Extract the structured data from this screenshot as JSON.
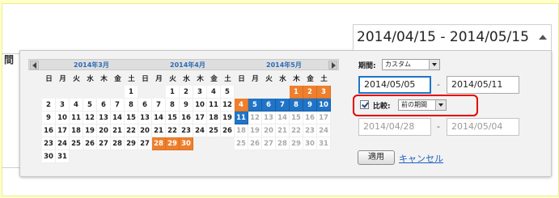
{
  "side_label": "間",
  "date_range_text": "2014/04/15 - 2014/05/15",
  "calendar": {
    "months": [
      {
        "label": "2014年3月",
        "weekdays": [
          "日",
          "月",
          "火",
          "水",
          "木",
          "金",
          "土"
        ],
        "weeks": [
          [
            "",
            "",
            "",
            "",
            "",
            "",
            "1"
          ],
          [
            "2",
            "3",
            "4",
            "5",
            "6",
            "7",
            "8"
          ],
          [
            "9",
            "10",
            "11",
            "12",
            "13",
            "14",
            "15"
          ],
          [
            "16",
            "17",
            "18",
            "19",
            "20",
            "21",
            "22"
          ],
          [
            "23",
            "24",
            "25",
            "26",
            "27",
            "28",
            "29"
          ],
          [
            "30",
            "31",
            "",
            "",
            "",
            "",
            ""
          ]
        ]
      },
      {
        "label": "2014年4月",
        "weekdays": [
          "日",
          "月",
          "火",
          "水",
          "木",
          "金",
          "土"
        ],
        "weeks": [
          [
            "",
            "",
            "1",
            "2",
            "3",
            "4",
            "5"
          ],
          [
            "6",
            "7",
            "8",
            "9",
            "10",
            "11",
            "12"
          ],
          [
            "13",
            "14",
            "15",
            "16",
            "17",
            "18",
            "19"
          ],
          [
            "20",
            "21",
            "22",
            "23",
            "24",
            "25",
            "26"
          ],
          [
            "27",
            "28",
            "29",
            "30",
            "",
            "",
            ""
          ]
        ]
      },
      {
        "label": "2014年5月",
        "weekdays": [
          "日",
          "月",
          "火",
          "水",
          "木",
          "金",
          "土"
        ],
        "weeks": [
          [
            "",
            "",
            "",
            "",
            "1",
            "2",
            "3"
          ],
          [
            "4",
            "5",
            "6",
            "7",
            "8",
            "9",
            "10"
          ],
          [
            "11",
            "12",
            "13",
            "14",
            "15",
            "16",
            "17"
          ],
          [
            "18",
            "19",
            "20",
            "21",
            "22",
            "23",
            "24"
          ],
          [
            "25",
            "26",
            "27",
            "28",
            "29",
            "30",
            "31"
          ]
        ]
      }
    ],
    "orange_dates": [
      "2014-04-28",
      "2014-04-29",
      "2014-04-30",
      "2014-05-01",
      "2014-05-02",
      "2014-05-03",
      "2014-05-04"
    ],
    "blue_dates": [
      "2014-05-05",
      "2014-05-06",
      "2014-05-07",
      "2014-05-08",
      "2014-05-09",
      "2014-05-10",
      "2014-05-11"
    ],
    "colors": {
      "orange": "#ee7f2d",
      "blue": "#1f74c7"
    }
  },
  "period": {
    "label": "期間:",
    "selected": "カスタム"
  },
  "range": {
    "start": "2014/05/05",
    "separator": "-",
    "end": "2014/05/11"
  },
  "compare": {
    "label": "比較:",
    "checked": true,
    "selected": "前の期間"
  },
  "compare_range": {
    "start": "2014/04/28",
    "separator": "-",
    "end": "2014/05/04"
  },
  "buttons": {
    "apply": "適用",
    "cancel": "キャンセル"
  },
  "highlight_color": "#e60000"
}
